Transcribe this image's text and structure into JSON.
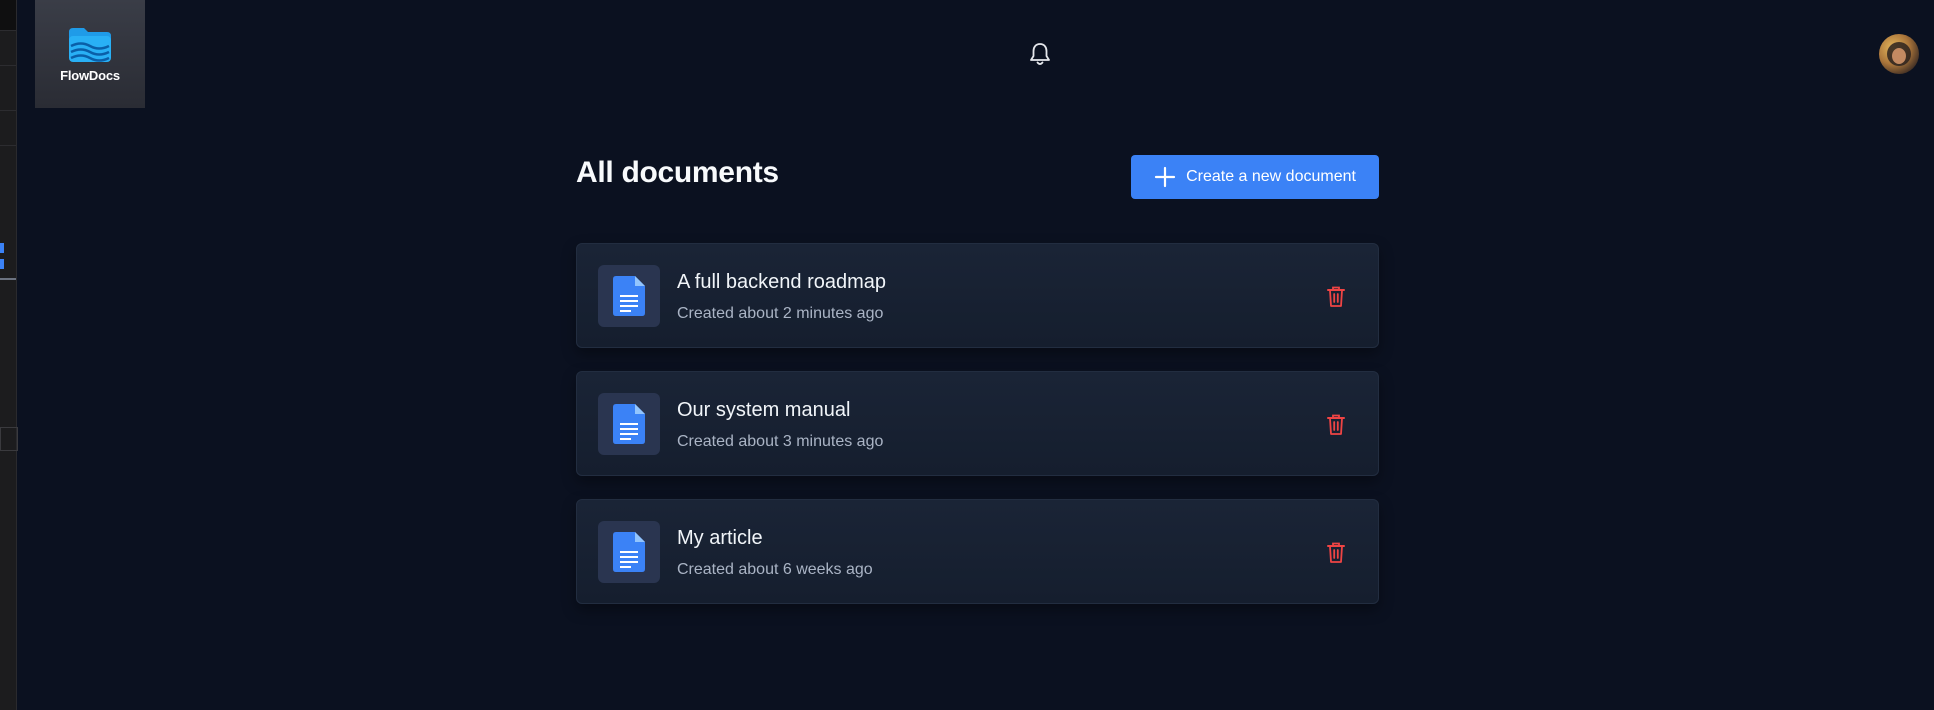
{
  "app": {
    "name": "FlowDocs"
  },
  "header": {
    "notifications_icon": "bell-icon",
    "avatar_icon": "user-avatar"
  },
  "main": {
    "title": "All documents",
    "create_button": {
      "label": "Create a new document",
      "icon": "plus-icon"
    },
    "documents": [
      {
        "title": "A full backend roadmap",
        "created": "Created about 2 minutes ago"
      },
      {
        "title": "Our system manual",
        "created": "Created about 3 minutes ago"
      },
      {
        "title": "My article",
        "created": "Created about 6 weeks ago"
      }
    ]
  },
  "colors": {
    "background": "#0b1120",
    "card": "#172033",
    "accent": "#3b82f6",
    "doc_icon": "#3b82f6",
    "delete": "#ef4444",
    "muted_text": "#aab4c5"
  }
}
